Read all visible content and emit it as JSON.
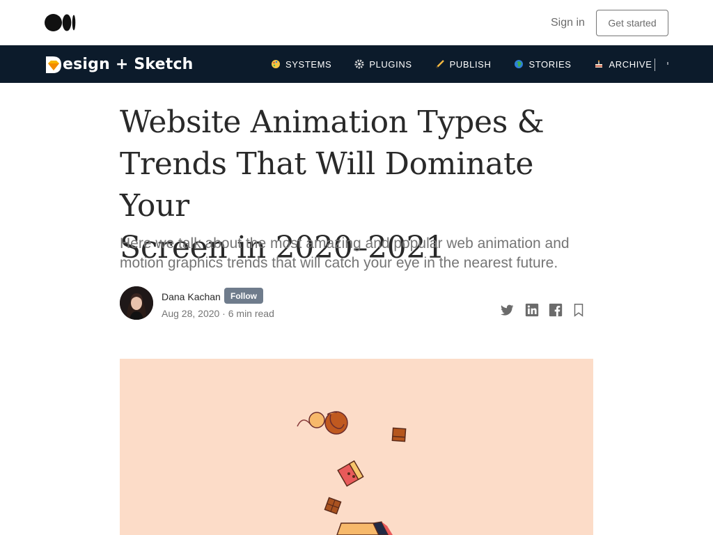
{
  "topbar": {
    "logo_icon": "medium-logo-icon",
    "signin_label": "Sign in",
    "getstarted_label": "Get started"
  },
  "publication": {
    "title": "esign + Sketch",
    "logo_icon": "design-sketch-logo-icon",
    "background": "#0c1b2b",
    "nav": [
      {
        "label": "SYSTEMS",
        "icon": "palette-icon"
      },
      {
        "label": "PLUGINS",
        "icon": "gear-icon"
      },
      {
        "label": "PUBLISH",
        "icon": "pencil-icon"
      },
      {
        "label": "STORIES",
        "icon": "globe-icon"
      },
      {
        "label": "ARCHIVE",
        "icon": "cake-icon"
      }
    ]
  },
  "article": {
    "title_line1": "Website Animation Types &",
    "title_line2": "Trends That Will Dominate Your",
    "title_line3": "Screen in 2020–2021",
    "subtitle_line1": "Here we talk about the most amazing and popular web animation and",
    "subtitle_line2": "motion graphics trends that will catch your eye in the nearest future.",
    "author": {
      "name": "Dana Kachan",
      "follow_label": "Follow",
      "meta": "Aug 28, 2020 · 6 min read"
    },
    "share": [
      "twitter-icon",
      "linkedin-icon",
      "facebook-icon",
      "bookmark-icon"
    ],
    "hero_background": "#fcdcc8"
  }
}
